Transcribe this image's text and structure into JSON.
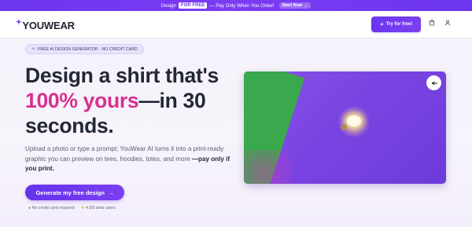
{
  "promo": {
    "prefix": "Design",
    "highlight": "FOR FREE",
    "suffix": "— Pay Only When You Order!",
    "cta": "Start Now"
  },
  "header": {
    "logo": "YOUWEAR",
    "try_button": "Try for free!"
  },
  "hero": {
    "badge": "FREE AI DESIGN GENERATOR · NO CREDIT CARD",
    "title_line1": "Design a shirt that's",
    "title_accent": "100% yours",
    "title_rest": "—in 30",
    "title_line3": "seconds.",
    "description": "Upload a photo or type a prompt; YouWear AI turns it into a print-ready graphic you can preview on tees, hoodies, totes, and more",
    "description_bold": "—pay only if you print.",
    "generate_button": "Generate my free design",
    "trust_no_card": "No credit card required",
    "trust_rating": "4.9/5 beta users"
  },
  "colors": {
    "brand": "#6c35ef",
    "accent": "#d9308f"
  },
  "icons": {
    "cart": "cart-icon",
    "user": "user-icon",
    "mute": "mute-icon"
  }
}
